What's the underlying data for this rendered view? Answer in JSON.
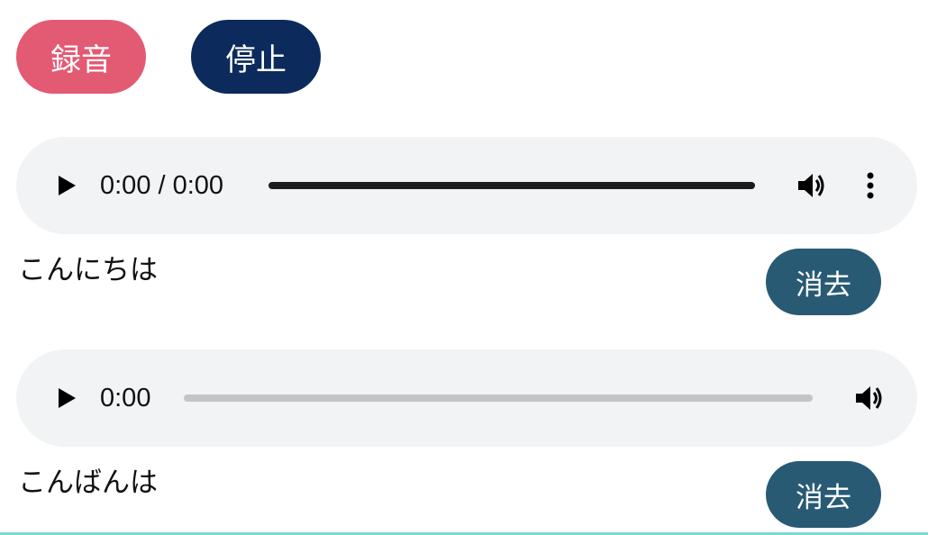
{
  "colors": {
    "record_bg": "#e35a73",
    "stop_bg": "#0c2b5c",
    "delete_bg": "#285a74",
    "player_bg": "#f1f3f4",
    "track_active": "#1b1b1b",
    "track_inactive": "#c4c4c4",
    "divider": "#7fd7d4"
  },
  "controls": {
    "record_label": "録音",
    "stop_label": "停止"
  },
  "recordings": [
    {
      "audio": {
        "time": "0:00 / 0:00",
        "icons": [
          "play-icon",
          "volume-icon",
          "more-vert-icon"
        ]
      },
      "label": "こんにちは",
      "delete_label": "消去"
    },
    {
      "audio": {
        "time": "0:00",
        "icons": [
          "play-icon",
          "volume-icon"
        ]
      },
      "label": "こんばんは",
      "delete_label": "消去"
    }
  ]
}
